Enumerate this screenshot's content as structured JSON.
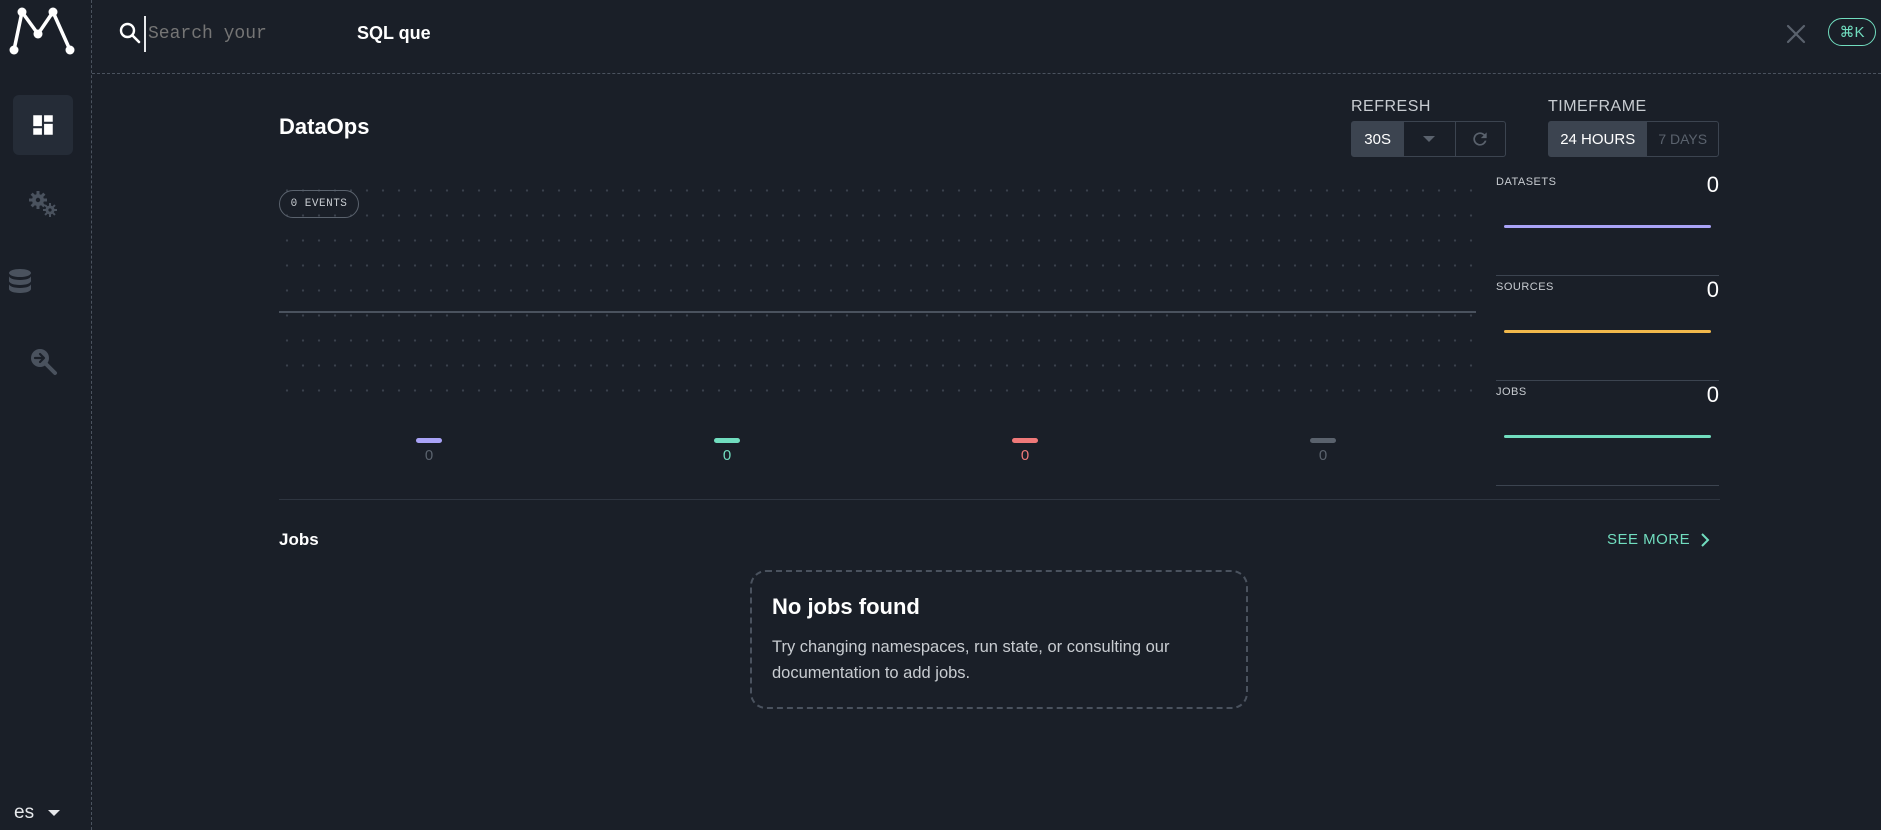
{
  "search": {
    "placeholder": "Search your",
    "typed_text": "SQL que",
    "shortcut": "⌘K"
  },
  "sidebar": {
    "items": [
      {
        "icon": "dashboard-icon",
        "active": true
      },
      {
        "icon": "gears-icon",
        "active": false
      },
      {
        "icon": "database-icon",
        "active": false
      },
      {
        "icon": "search-arrow-icon",
        "active": false
      }
    ],
    "language": "es"
  },
  "header": {
    "title": "DataOps"
  },
  "refresh": {
    "label": "REFRESH",
    "value": "30S"
  },
  "timeframe": {
    "label": "TIMEFRAME",
    "options": [
      "24 HOURS",
      "7 DAYS"
    ],
    "selected": "24 HOURS"
  },
  "events": {
    "badge": "0 EVENTS"
  },
  "chart_data": {
    "type": "line",
    "series": [
      {
        "color": "#a9a3f7",
        "total": 0
      },
      {
        "color": "#71ddbf",
        "total": 0
      },
      {
        "color": "#ef7979",
        "total": 0
      },
      {
        "color": "#5a626d",
        "total": 0
      }
    ]
  },
  "legend": [
    "0",
    "0",
    "0",
    "0"
  ],
  "stats": [
    {
      "label": "DATASETS",
      "value": "0",
      "color": "#a9a3f7"
    },
    {
      "label": "SOURCES",
      "value": "0",
      "color": "#f1b84c"
    },
    {
      "label": "JOBS",
      "value": "0",
      "color": "#71ddbf"
    }
  ],
  "jobs": {
    "title": "Jobs",
    "see_more": "SEE MORE",
    "empty_title": "No jobs found",
    "empty_text": "Try changing namespaces, run state, or consulting our documentation to add jobs."
  }
}
